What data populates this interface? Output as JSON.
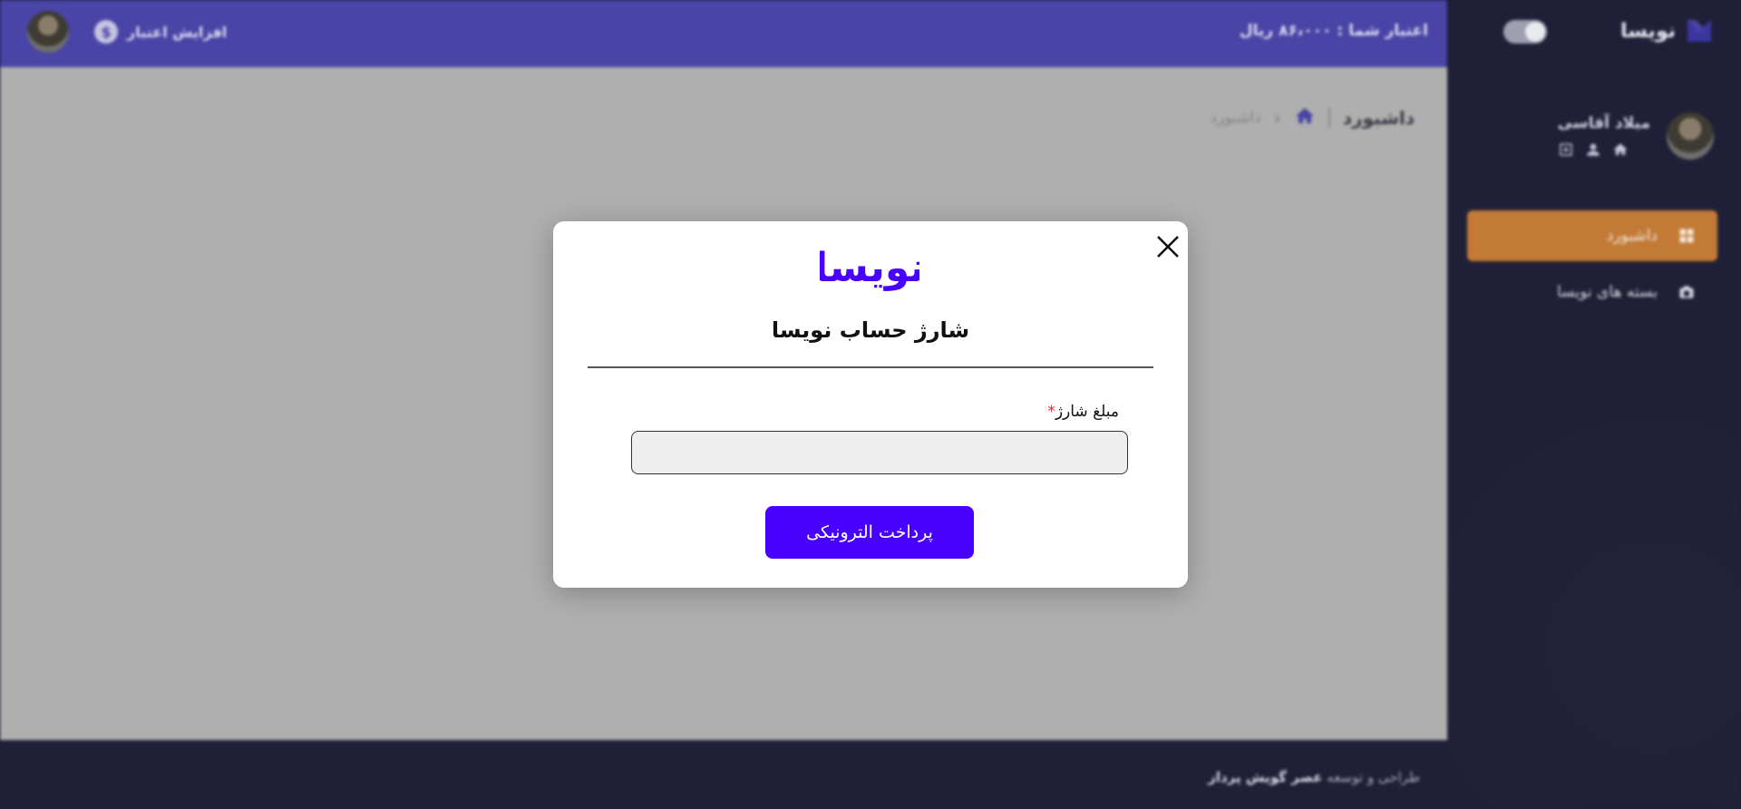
{
  "sidebar": {
    "brand_name": "نویسا",
    "user_name": "میلاد آقاسی",
    "user_icons": [
      "home-icon",
      "user-icon",
      "plus-square-icon"
    ],
    "items": [
      {
        "label": "داشبورد",
        "icon": "grid-icon",
        "active": true
      },
      {
        "label": "بسته های نویسا",
        "icon": "camera-icon",
        "active": false
      }
    ],
    "toggle": "theme-toggle"
  },
  "topbar": {
    "credit_text": "اعتبار شما : ۸۶،۰۰۰ ریال",
    "add_credit_label": "افزایش اعتبار",
    "add_credit_icon": "$"
  },
  "breadcrumb": {
    "title": "داشبورد",
    "current": "داشبورد"
  },
  "footer": {
    "prefix": "طراحی و توسعه",
    "company": "عصر گویش پرداز"
  },
  "modal": {
    "logo_text": "نویسا",
    "title": "شارژ حساب نویسا",
    "amount_label": "مبلغ شارژ",
    "required_mark": "*",
    "amount_value": "",
    "submit_label": "پرداخت الترونیکی"
  },
  "colors": {
    "topbar": "#4a44a6",
    "sidebar": "#1f2037",
    "active_item": "#c27a36",
    "primary_button": "#4800ff",
    "brand_logo": "#4800ff"
  }
}
